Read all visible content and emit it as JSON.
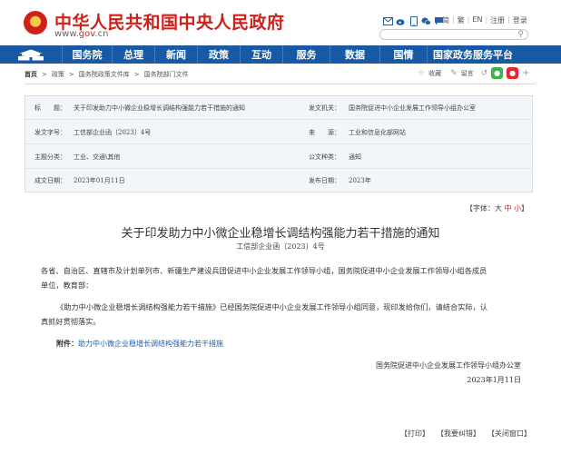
{
  "header": {
    "site_title": "中华人民共和国中央人民政府",
    "url_pre": "www.",
    "url_brand": "gov",
    "url_post": ".cn",
    "tool_icons": [
      "mail-icon",
      "weibo-icon",
      "mobile-icon",
      "wechat-icon",
      "chat-icon"
    ],
    "links": [
      "简",
      "繁",
      "EN",
      "注册",
      "登录"
    ],
    "search_placeholder": ""
  },
  "nav": {
    "home_icon": "tiananmen-icon",
    "items": [
      "国务院",
      "总理",
      "新闻",
      "政策",
      "互动",
      "服务",
      "数据",
      "国情",
      "国家政务服务平台"
    ]
  },
  "breadcrumb": {
    "items": [
      "首页",
      "政策",
      "国务院政策文件库",
      "国务院部门文件"
    ],
    "separator": ">"
  },
  "share": {
    "favorite": "收藏",
    "comment": "留言"
  },
  "info": {
    "title_label": "标　　题：",
    "title": "关于印发助力中小微企业稳增长调结构强能力若干措施的通知",
    "issuer_label": "发文机关：",
    "issuer": "国务院促进中小企业发展工作领导小组办公室",
    "docno_label": "发文字号：",
    "docno": "工信部企业函〔2023〕4号",
    "source_label": "来　　源：",
    "source": "工业和信息化部网站",
    "topic_label": "主题分类：",
    "topic": "工业、交通\\其他",
    "type_label": "公文种类：",
    "type": "通知",
    "written_label": "成文日期：",
    "written": "2023年01月11日",
    "published_label": "发布日期：",
    "published": "2023年"
  },
  "font_size": {
    "prefix": "【字体：",
    "large": "大",
    "medium": "中",
    "small": "小",
    "suffix": "】"
  },
  "article": {
    "title": "关于印发助力中小微企业稳增长调结构强能力若干措施的通知",
    "doc_no": "工信部企业函〔2023〕4号",
    "para1_line1": "各省、自治区、直辖市及计划单列市、新疆生产建设兵团促进中小企业发展工作领导小组，国务院促进中小企业发展工作领导小组各成员",
    "para1_line2": "单位，教育部：",
    "para2_line1": "《助力中小微企业稳增长调结构强能力若干措施》已经国务院促进中小企业发展工作领导小组同意，现印发给你们，请结合实际，认",
    "para2_line2": "真抓好贯彻落实。",
    "attachment_label": "附件：",
    "attachment_link": "助力中小微企业稳增长调结构强能力若干措施",
    "sign_org": "国务院促进中小企业发展工作领导小组办公室",
    "sign_date": "2023年1月11日"
  },
  "footer": {
    "print": "【打印】",
    "report": "【我要纠错】",
    "close": "【关闭窗口】"
  },
  "colors": {
    "brand_red": "#d0201a",
    "nav_blue": "#1859a5",
    "link_blue": "#1f5fa9",
    "info_bg": "#f2f6fa"
  }
}
